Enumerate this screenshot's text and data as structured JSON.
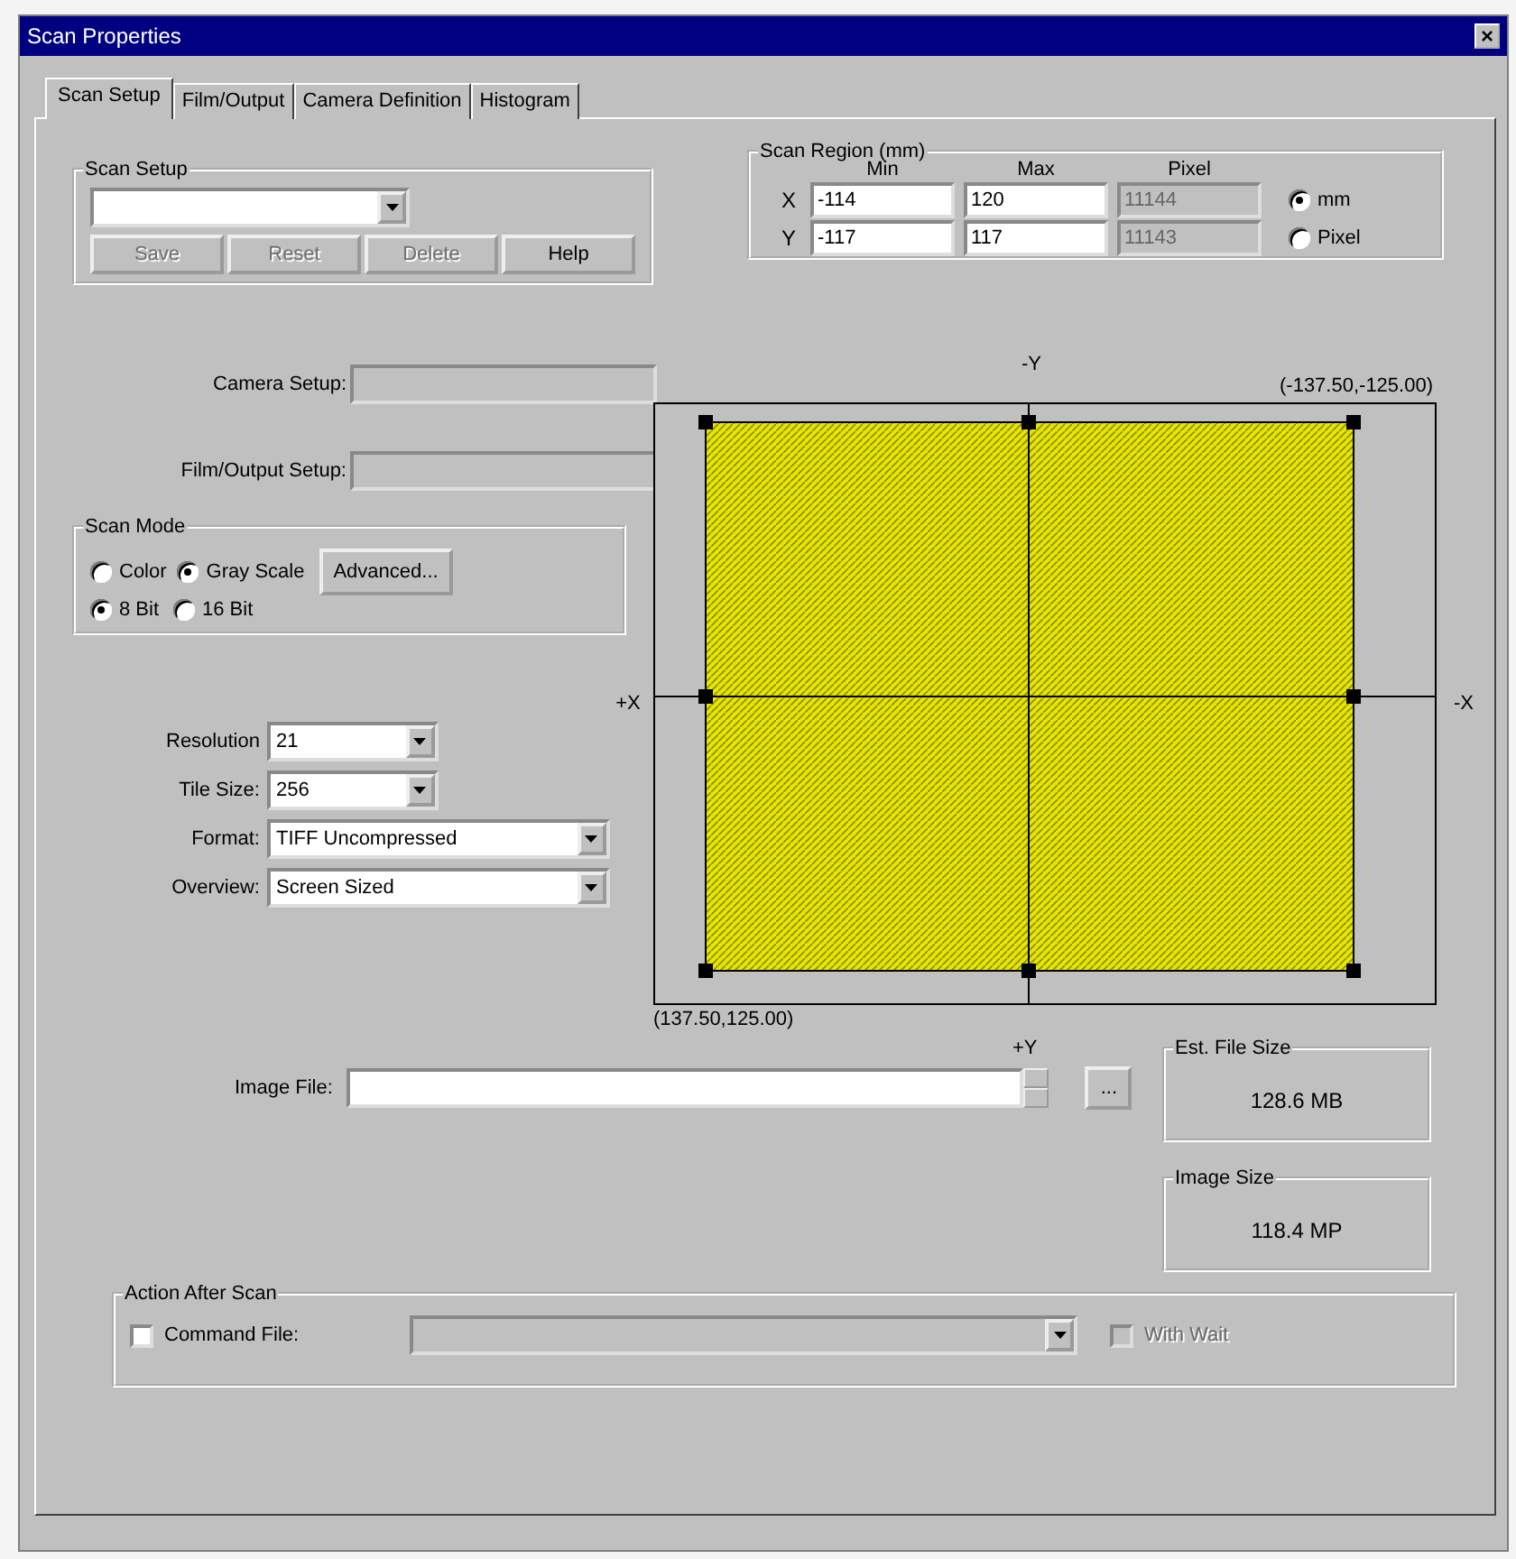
{
  "window": {
    "title": "Scan Properties",
    "close": "×"
  },
  "tabs": [
    {
      "label": "Scan Setup",
      "selected": true
    },
    {
      "label": "Film/Output",
      "selected": false
    },
    {
      "label": "Camera Definition",
      "selected": false
    },
    {
      "label": "Histogram",
      "selected": false
    }
  ],
  "scan_setup": {
    "title": "Scan Setup",
    "buttons": [
      {
        "label": "Save",
        "disabled": true
      },
      {
        "label": "Reset",
        "disabled": true
      },
      {
        "label": "Delete",
        "disabled": true
      },
      {
        "label": "Help",
        "disabled": false
      }
    ]
  },
  "setups": [
    {
      "label": "Camera Setup:"
    },
    {
      "label": "Film/Output Setup:"
    }
  ],
  "scan_mode": {
    "title": "Scan Mode",
    "color_modes": [
      {
        "label": "Color",
        "selected": false
      },
      {
        "label": "Gray Scale",
        "selected": true
      }
    ],
    "advanced_button": "Advanced...",
    "bit_depths": [
      {
        "label": "8 Bit",
        "selected": true
      },
      {
        "label": "16 Bit",
        "selected": false
      }
    ]
  },
  "settings": [
    {
      "label": "Resolution",
      "value": "21",
      "kind": "short"
    },
    {
      "label": "Tile Size:",
      "value": "256",
      "kind": "short"
    },
    {
      "label": "Format:",
      "value": "TIFF Uncompressed",
      "kind": "wide"
    },
    {
      "label": "Overview:",
      "value": "Screen Sized",
      "kind": "wide"
    }
  ],
  "scan_region": {
    "title": "Scan Region (mm)",
    "columns": [
      "Min",
      "Max",
      "Pixel"
    ],
    "pixel_disabled": true,
    "rows": [
      {
        "axis": "X",
        "min": "-114",
        "max": "120",
        "pixel": "11144"
      },
      {
        "axis": "Y",
        "min": "-117",
        "max": "117",
        "pixel": "11143"
      }
    ],
    "units": [
      {
        "label": "mm",
        "selected": true
      },
      {
        "label": "Pixel",
        "selected": false
      }
    ]
  },
  "preview": {
    "top_label": "-Y",
    "top_corner": "(-137.50,-125.00)",
    "left_label": "+X",
    "right_label": "-X",
    "bottom_corner": "(137.50,125.00)",
    "bottom_label": "+Y"
  },
  "image_file": {
    "label": "Image File:",
    "browse": "..."
  },
  "est_file_size": {
    "title": "Est. File Size",
    "value": "128.6 MB"
  },
  "image_size": {
    "title": "Image Size",
    "value": "118.4 MP"
  },
  "action_after_scan": {
    "title": "Action After Scan",
    "command_file": {
      "label": "Command File:",
      "checked": false
    },
    "command_disabled": true,
    "wait": {
      "label": "With Wait",
      "checked": false,
      "disabled": true
    }
  }
}
